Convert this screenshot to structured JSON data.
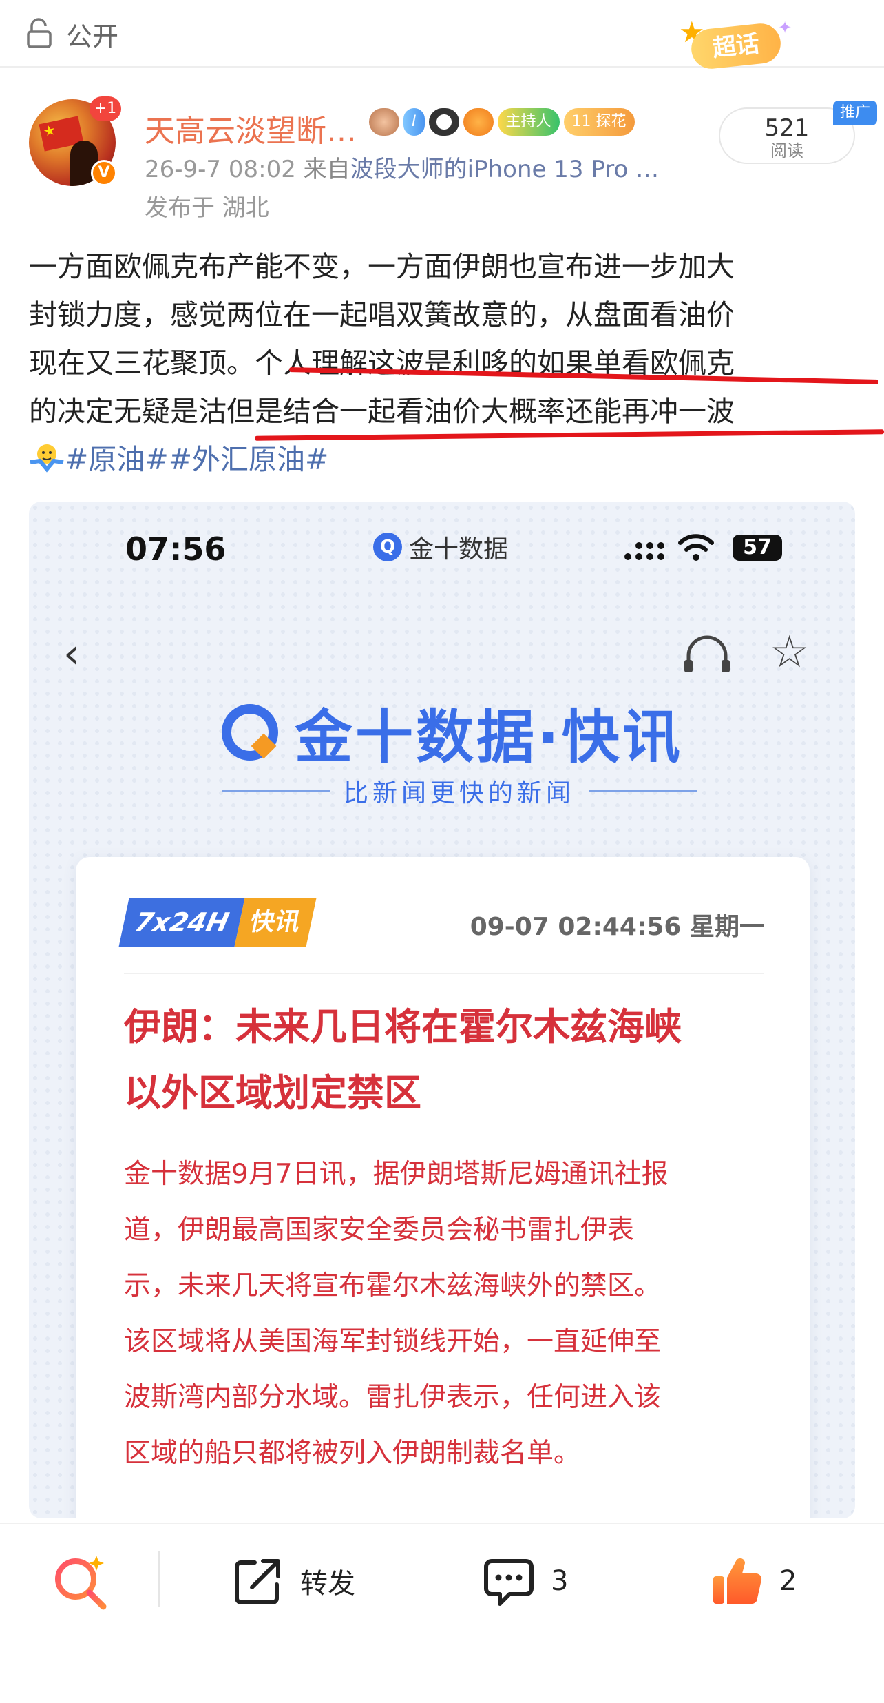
{
  "topbar": {
    "visibility": "公开",
    "chaohua_label": "超话"
  },
  "author": {
    "name": "天高云淡望断…",
    "plus_badge": "+1",
    "medals": [
      "I",
      "主持人",
      "探花"
    ],
    "medal_level": "11",
    "time": "26-9-7 08:02",
    "source_prefix": "来自",
    "device": "波段大师的iPhone 13 Pro …",
    "location": "发布于 湖北",
    "reads": "521",
    "reads_label": "阅读",
    "promo": "推广"
  },
  "post": {
    "line1": "一方面欧佩克布产能不变，一方面伊朗也宣布进一步加大",
    "line2": "封锁力度，感觉两位在一起唱双簧故意的，从盘面看油价",
    "line3a": "现在又三花聚顶。",
    "line3b": "个人理解这波是利哆的如果单看欧佩克",
    "line4": "的决定无疑是沽但是结合一起看油价大概率还能再冲一波",
    "topics": "#原油##外汇原油#"
  },
  "screenshot": {
    "status_time": "07:56",
    "app_name": "金十数据",
    "battery": "57",
    "logo_text": "金十数据·快讯",
    "slogan": "比新闻更快的新闻",
    "tag_a": "7x24H",
    "tag_b": "快讯",
    "timestamp": "09-07 02:44:56 星期一",
    "headline1": "伊朗：未来几日将在霍尔木兹海峡",
    "headline2": "以外区域划定禁区",
    "body": [
      "金十数据9月7日讯，据伊朗塔斯尼姆通讯社报",
      "道，伊朗最高国家安全委员会秘书雷扎伊表",
      "示，未来几天将宣布霍尔木兹海峡外的禁区。",
      "该区域将从美国海军封锁线开始，一直延伸至",
      "波斯湾内部分水域。雷扎伊表示，任何进入该",
      "区域的船只都将被列入伊朗制裁名单。"
    ]
  },
  "actions": {
    "share_label": "转发",
    "comment_count": "3",
    "like_count": "2"
  },
  "colors": {
    "accent_name": "#eb7350",
    "topic_link": "#4e6fae",
    "underline": "#e3161b",
    "jin10_blue": "#3a6ee8",
    "jin10_red": "#d6313b"
  }
}
